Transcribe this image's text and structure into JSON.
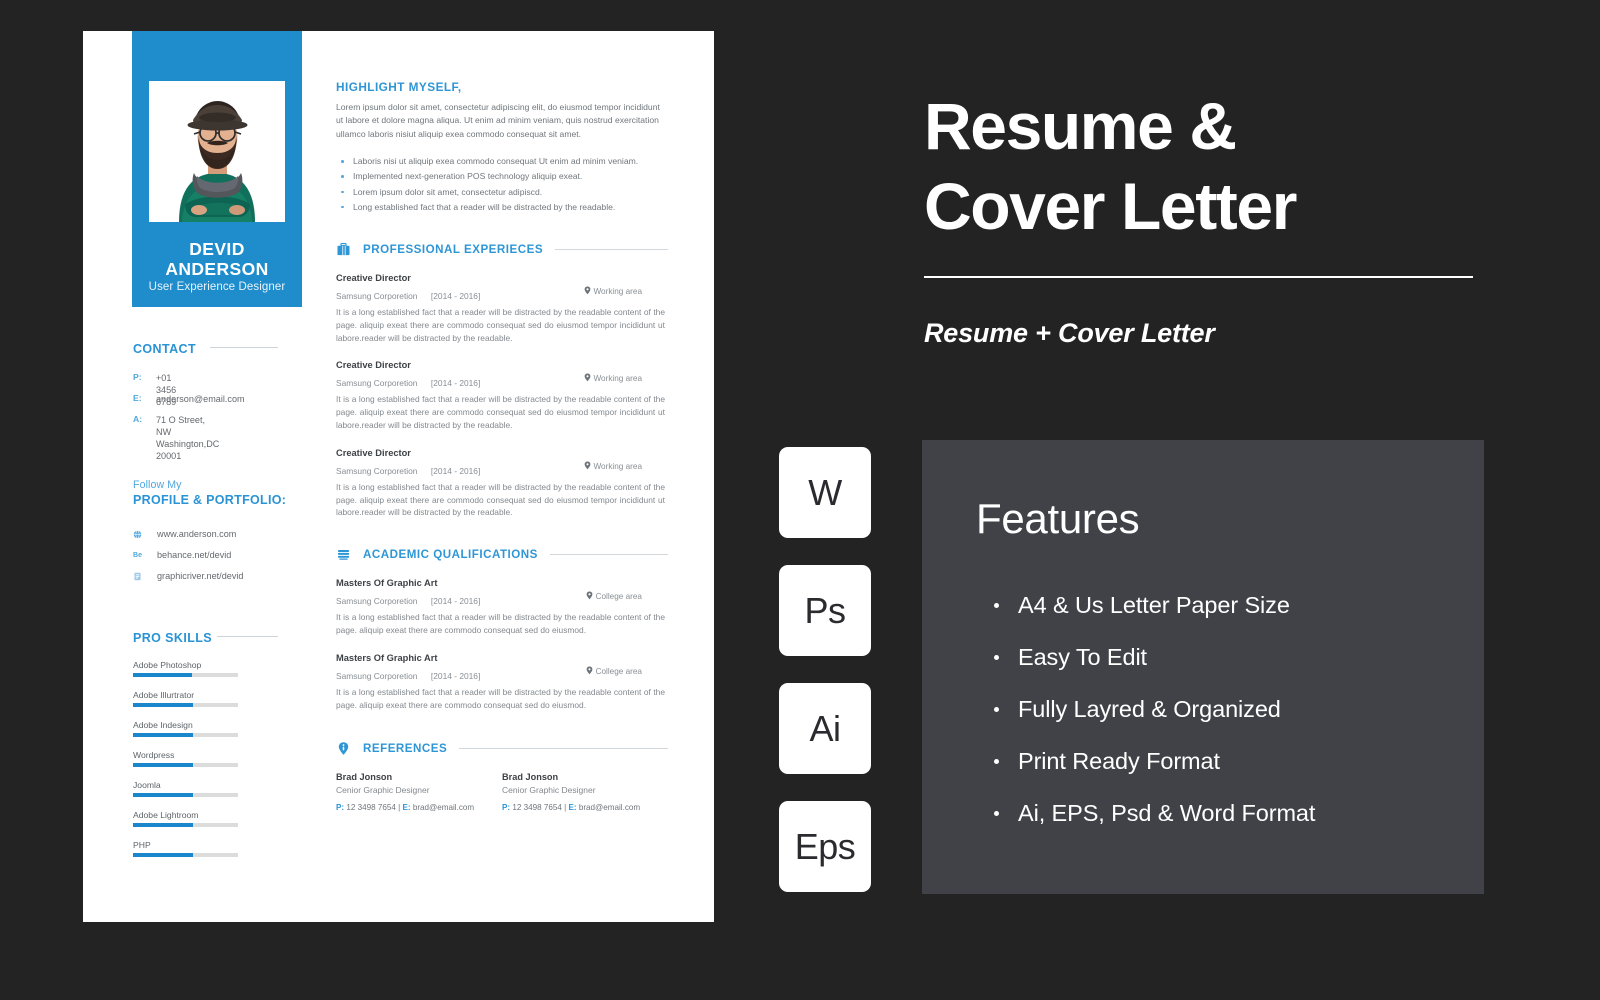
{
  "resume": {
    "profile": {
      "first_name": "DEVID",
      "last_name": "ANDERSON",
      "role": "User Experience Designer",
      "photo_icon": "portrait-photo"
    },
    "contact": {
      "title": "CONTACT",
      "rows": [
        {
          "key": "P:",
          "value": "+01 3456 6789"
        },
        {
          "key": "E:",
          "value": "anderson@email.com"
        },
        {
          "key": "A:",
          "value": "71 O Street, NW\nWashington,DC 20001"
        }
      ]
    },
    "portfolio": {
      "small_title": "Follow My",
      "big_title": "PROFILE & PORTFOLIO:",
      "links": [
        {
          "icon": "globe-icon",
          "glyph": "⊕",
          "text": "www.anderson.com"
        },
        {
          "icon": "behance-icon",
          "glyph": "Be",
          "text": "behance.net/devid"
        },
        {
          "icon": "graphicriver-icon",
          "glyph": "▤",
          "text": "graphicriver.net/devid"
        }
      ]
    },
    "skills": {
      "title": "PRO SKILLS",
      "items": [
        {
          "name": "Adobe Photoshop",
          "percent": 56
        },
        {
          "name": "Adobe Illurtrator",
          "percent": 57
        },
        {
          "name": "Adobe Indesign",
          "percent": 57
        },
        {
          "name": "Wordpress",
          "percent": 57
        },
        {
          "name": "Joomla",
          "percent": 57
        },
        {
          "name": "Adobe Lightroom",
          "percent": 57
        },
        {
          "name": "PHP",
          "percent": 57
        }
      ]
    },
    "highlight": {
      "title": "HIGHLIGHT MYSELF,",
      "paragraph": "Lorem ipsum dolor sit amet, consectetur adipiscing elit, do eiusmod tempor incididunt ut labore et dolore magna aliqua. Ut enim ad minim veniam, quis nostrud exercitation ullamco laboris nisiut aliquip exea commodo consequat sit amet.",
      "bullets": [
        "Laboris nisi ut aliquip exea commodo consequat Ut enim ad minim veniam.",
        "Implemented next-generation POS technology aliquip exeat.",
        "Lorem ipsum dolor sit amet, consectetur adipiscd.",
        "Long established fact that a reader will be distracted by the readable."
      ]
    },
    "experience": {
      "icon": "briefcase-icon",
      "title": "PROFESSIONAL EXPERIECES",
      "entries": [
        {
          "title": "Creative Director",
          "org": "Samsung Corporetion",
          "dates": "[2014 - 2016]",
          "place": "Working area",
          "place_icon": "map-pin-icon",
          "desc": "It is a long established fact that a reader will be distracted by the readable content of the page. aliquip exeat there are commodo consequat sed do eiusmod tempor incididunt ut labore.reader will be distracted by the readable."
        },
        {
          "title": "Creative Director",
          "org": "Samsung Corporetion",
          "dates": "[2014 - 2016]",
          "place": "Working area",
          "place_icon": "map-pin-icon",
          "desc": "It is a long established fact that a reader will be distracted by the readable content of the page. aliquip exeat there are commodo consequat sed do eiusmod tempor incididunt ut labore.reader will be distracted by the readable."
        },
        {
          "title": "Creative Director",
          "org": "Samsung Corporetion",
          "dates": "[2014 - 2016]",
          "place": "Working area",
          "place_icon": "map-pin-icon",
          "desc": "It is a long established fact that a reader will be distracted by the readable content of the page. aliquip exeat there are commodo consequat sed do eiusmod tempor incididunt ut labore.reader will be distracted by the readable."
        }
      ]
    },
    "academic": {
      "icon": "books-icon",
      "title": "ACADEMIC QUALIFICATIONS",
      "entries": [
        {
          "title": "Masters Of Graphic Art",
          "org": "Samsung Corporetion",
          "dates": "[2014 - 2016]",
          "place": "College area",
          "place_icon": "map-pin-icon",
          "desc": "It is a long established fact that a reader will be distracted by the readable content of the page. aliquip exeat there are commodo consequat sed do eiusmod."
        },
        {
          "title": "Masters Of Graphic Art",
          "org": "Samsung Corporetion",
          "dates": "[2014 - 2016]",
          "place": "College area",
          "place_icon": "map-pin-icon",
          "desc": "It is a long established fact that a reader will be distracted by the readable content of the page. aliquip exeat there are commodo consequat sed do eiusmod."
        }
      ]
    },
    "references": {
      "icon": "info-pin-icon",
      "title": "REFERENCES",
      "people": [
        {
          "name": "Brad Jonson",
          "role": "Cenior Graphic Designer",
          "phone_key": "P:",
          "phone": "12 3498 7654",
          "separator": "|",
          "email_key": "E:",
          "email": "brad@email.com"
        },
        {
          "name": "Brad Jonson",
          "role": "Cenior Graphic Designer",
          "phone_key": "P:",
          "phone": "12 3498 7654",
          "separator": "|",
          "email_key": "E:",
          "email": "brad@email.com"
        }
      ]
    }
  },
  "promo": {
    "title_line1": "Resume &",
    "title_line2": "Cover Letter",
    "subtitle": "Resume + Cover Letter",
    "badges": [
      {
        "label": "W",
        "name": "word-format-badge"
      },
      {
        "label": "Ps",
        "name": "photoshop-format-badge"
      },
      {
        "label": "Ai",
        "name": "illustrator-format-badge"
      },
      {
        "label": "Eps",
        "name": "eps-format-badge"
      }
    ],
    "features": {
      "title": "Features",
      "items": [
        "A4 & Us Letter Paper Size",
        "Easy To Edit",
        "Fully Layred & Organized",
        "Print Ready Format",
        "Ai, EPS, Psd & Word Format"
      ]
    }
  },
  "colors": {
    "background": "#232323",
    "accent_blue": "#1f8ccb",
    "heading_blue": "#2f96d6",
    "card_gray": "#414248",
    "paper_white": "#ffffff"
  }
}
